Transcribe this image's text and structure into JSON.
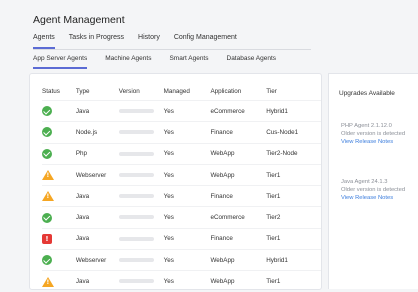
{
  "page": {
    "title": "Agent Management"
  },
  "nav": {
    "tabs": [
      {
        "label": "Agents",
        "active": true
      },
      {
        "label": "Tasks in Progress",
        "active": false
      },
      {
        "label": "History",
        "active": false
      },
      {
        "label": "Config Management",
        "active": false
      }
    ],
    "subtabs": [
      {
        "label": "App Server Agents",
        "active": true
      },
      {
        "label": "Machine Agents",
        "active": false
      },
      {
        "label": "Smart Agents",
        "active": false
      },
      {
        "label": "Database Agents",
        "active": false
      }
    ]
  },
  "table": {
    "columns": [
      "Status",
      "Type",
      "Version",
      "Managed",
      "Application",
      "Tier"
    ],
    "rows": [
      {
        "status": "ok",
        "type": "Java",
        "managed": "Yes",
        "application": "eCommerce",
        "tier": "Hybrid1"
      },
      {
        "status": "ok",
        "type": "Node.js",
        "managed": "Yes",
        "application": "Finance",
        "tier": "Cus-Node1"
      },
      {
        "status": "ok",
        "type": "Php",
        "managed": "Yes",
        "application": "WebApp",
        "tier": "Tier2-Node"
      },
      {
        "status": "warning",
        "type": "Webserver",
        "managed": "Yes",
        "application": "WebApp",
        "tier": "Tier1"
      },
      {
        "status": "warning",
        "type": "Java",
        "managed": "Yes",
        "application": "Finance",
        "tier": "Tier1"
      },
      {
        "status": "ok",
        "type": "Java",
        "managed": "Yes",
        "application": "eCommerce",
        "tier": "Tier2"
      },
      {
        "status": "error",
        "type": "Java",
        "managed": "Yes",
        "application": "Finance",
        "tier": "Tier1"
      },
      {
        "status": "ok",
        "type": "Webserver",
        "managed": "Yes",
        "application": "WebApp",
        "tier": "Hybrid1"
      },
      {
        "status": "warning",
        "type": "Java",
        "managed": "Yes",
        "application": "WebApp",
        "tier": "Tier1"
      }
    ]
  },
  "sidebar": {
    "title": "Upgrades Available",
    "upgrades": [
      {
        "version": "PHP Agent 2.1.12.0",
        "note": "Older version is detected",
        "link": "View Release Notes"
      },
      {
        "version": "Java Agent 24.1.3",
        "note": "Older version is detected",
        "link": "View Release Notes"
      }
    ]
  },
  "colors": {
    "accent": "#5b6bd4",
    "ok": "#4caf50",
    "warning": "#f5a623",
    "error": "#e53935",
    "link": "#3b7ddd"
  },
  "icons": {
    "ok": "check-circle-icon",
    "warning": "warning-triangle-icon",
    "error": "error-square-icon"
  }
}
